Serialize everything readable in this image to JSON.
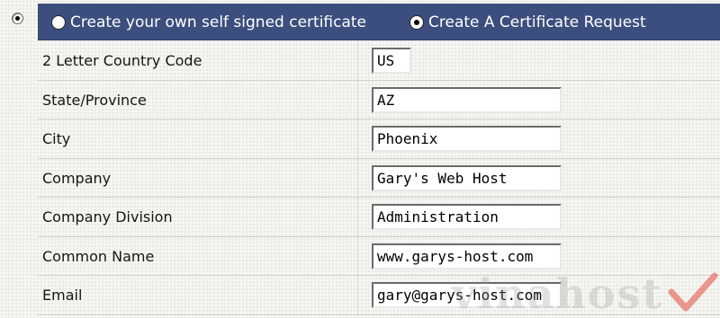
{
  "header": {
    "options": [
      {
        "label": "Create your own self signed certificate",
        "checked": false
      },
      {
        "label": "Create A Certificate Request",
        "checked": true
      }
    ],
    "background_color": "#3b4e7e"
  },
  "outer_radio": {
    "checked": true
  },
  "form": {
    "rows": [
      {
        "label": "2 Letter Country Code",
        "value": "US"
      },
      {
        "label": "State/Province",
        "value": "AZ"
      },
      {
        "label": "City",
        "value": "Phoenix"
      },
      {
        "label": "Company",
        "value": "Gary's Web Host"
      },
      {
        "label": "Company Division",
        "value": "Administration"
      },
      {
        "label": "Common Name",
        "value": "www.garys-host.com"
      },
      {
        "label": "Email",
        "value": "gary@garys-host.com"
      }
    ]
  },
  "watermark": {
    "text": "vinahost",
    "accent_color": "#e03a2a"
  }
}
